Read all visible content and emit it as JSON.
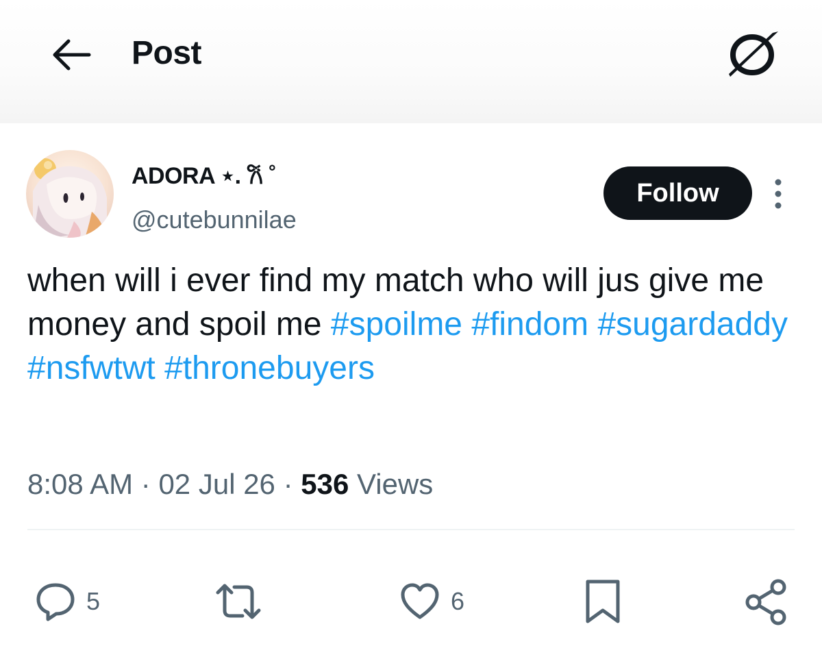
{
  "header": {
    "title": "Post"
  },
  "author": {
    "display_name": "ADORA ⋆. 𐙚 ˚",
    "handle": "@cutebunnilae",
    "follow_label": "Follow"
  },
  "post": {
    "text": "when will i ever find my match who will jus give me money and spoil me ",
    "hashtags": [
      "#spoilme",
      "#findom",
      "#sugardaddy",
      "#nsfwtwt",
      "#thronebuyers"
    ],
    "time": "8:08 AM",
    "date": "02 Jul 26",
    "views_count": "536",
    "views_label": "Views"
  },
  "actions": {
    "reply_count": "5",
    "like_count": "6"
  },
  "colors": {
    "hashtag": "#1d9bf0",
    "text": "#0f1419",
    "muted": "#536471",
    "follow_bg": "#0f1419"
  }
}
